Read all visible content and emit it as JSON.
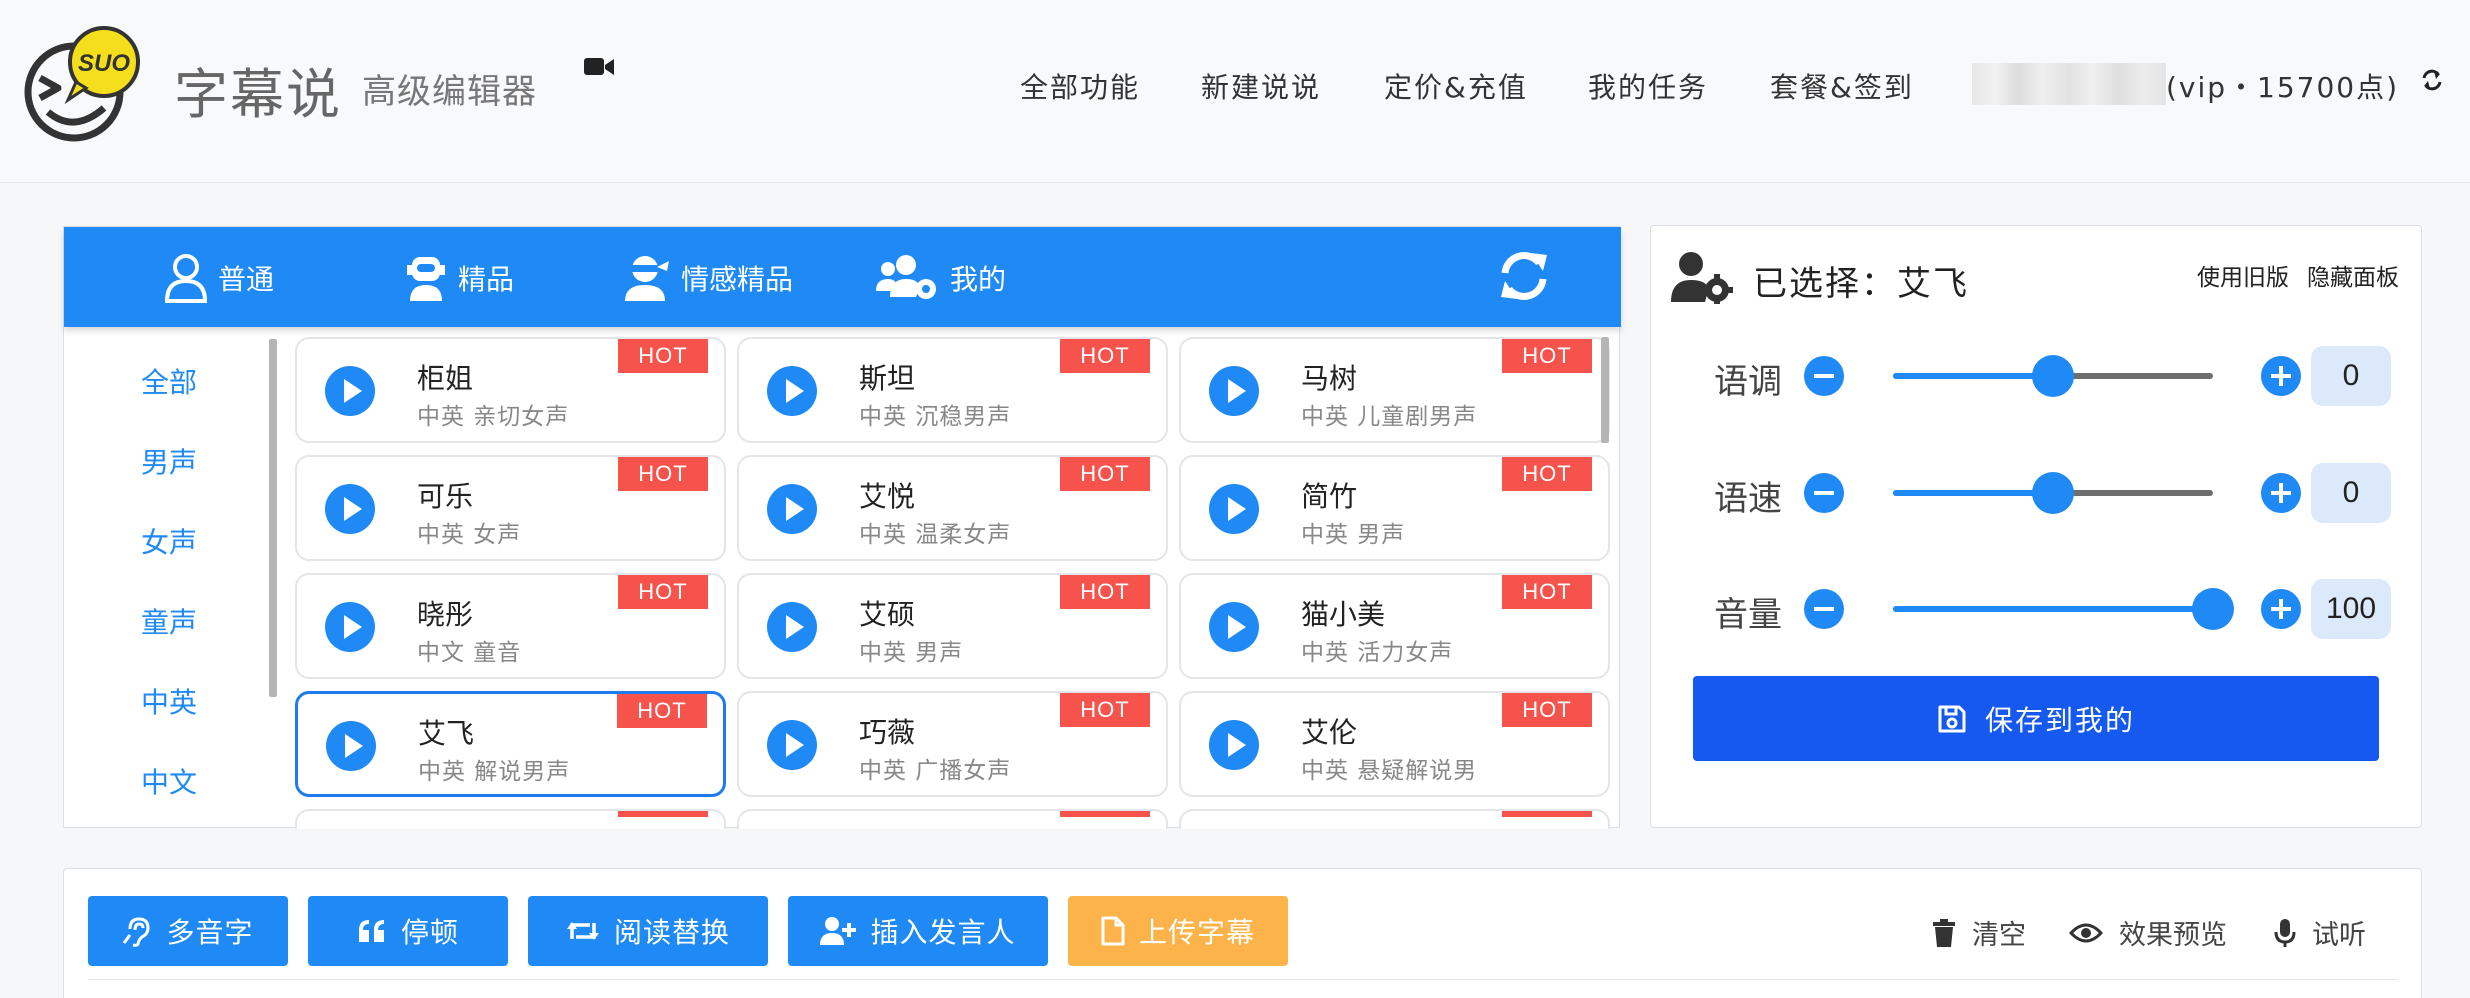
{
  "header": {
    "brand": "字幕说",
    "brand_logo_text": "SUO",
    "subtitle": "高级编辑器",
    "nav": [
      "全部功能",
      "新建说说",
      "定价&充值",
      "我的任务",
      "套餐&签到"
    ],
    "user_vip": "(vip・15700点)"
  },
  "voice_tabs": [
    "普通",
    "精品",
    "情感精品",
    "我的"
  ],
  "filters": [
    "全部",
    "男声",
    "女声",
    "童声",
    "中英",
    "中文"
  ],
  "hot_label": "HOT",
  "voices": [
    {
      "name": "柜姐",
      "desc": "中英 亲切女声"
    },
    {
      "name": "斯坦",
      "desc": "中英 沉稳男声"
    },
    {
      "name": "马树",
      "desc": "中英 儿童剧男声"
    },
    {
      "name": "可乐",
      "desc": "中英 女声"
    },
    {
      "name": "艾悦",
      "desc": "中英 温柔女声"
    },
    {
      "name": "简竹",
      "desc": "中英 男声"
    },
    {
      "name": "晓彤",
      "desc": "中文 童音"
    },
    {
      "name": "艾硕",
      "desc": "中英 男声"
    },
    {
      "name": "猫小美",
      "desc": "中英 活力女声"
    },
    {
      "name": "艾飞",
      "desc": "中英 解说男声"
    },
    {
      "name": "巧薇",
      "desc": "中英 广播女声"
    },
    {
      "name": "艾伦",
      "desc": "中英 悬疑解说男"
    }
  ],
  "settings": {
    "title": "已选择：艾飞",
    "link_old": "使用旧版",
    "link_hide": "隐藏面板",
    "params": [
      {
        "label": "语调",
        "value": "0",
        "level": 0.5
      },
      {
        "label": "语速",
        "value": "0",
        "level": 0.5
      },
      {
        "label": "音量",
        "value": "100",
        "level": 1.0
      }
    ],
    "save_label": "保存到我的"
  },
  "toolbar": {
    "buttons": [
      "多音字",
      "停顿",
      "阅读替换",
      "插入发言人",
      "上传字幕"
    ],
    "links": [
      "清空",
      "效果预览",
      "试听"
    ]
  },
  "colors": {
    "primary": "#1f8af5",
    "save": "#1559f0",
    "hot": "#f5534b",
    "upload": "#fbb34a",
    "logo_yellow": "#f5de1c"
  }
}
